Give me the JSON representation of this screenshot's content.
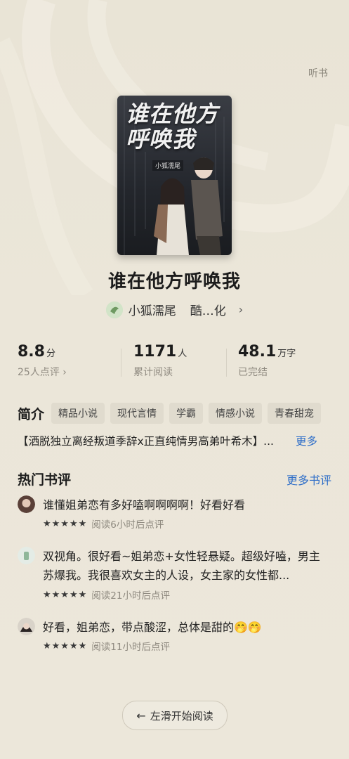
{
  "header": {
    "listen_label": "听书"
  },
  "book": {
    "cover_title": "谁在他方呼唤我",
    "cover_author": "小狐濡尾",
    "title": "谁在他方呼唤我",
    "author": "小狐濡尾",
    "publisher": "酷…化"
  },
  "stats": {
    "rating": "8.8",
    "rating_unit": "分",
    "rating_sub": "25人点评 ›",
    "readers": "1171",
    "readers_unit": "人",
    "readers_sub": "累计阅读",
    "words": "48.1",
    "words_unit": "万字",
    "words_sub": "已完结"
  },
  "intro": {
    "heading": "简介",
    "tags": [
      "精品小说",
      "现代言情",
      "学霸",
      "情感小说",
      "青春甜宠"
    ],
    "synopsis": "【洒脱独立离经叛道季辞x正直纯情男高弟叶希木】...",
    "more": "更多"
  },
  "reviews_section": {
    "heading": "热门书评",
    "more": "更多书评",
    "items": [
      {
        "text": "谁懂姐弟恋有多好嗑啊啊啊啊！好看好看",
        "stars": "★★★★★",
        "meta": "阅读6小时后点评"
      },
      {
        "text": "双视角。很好看~姐弟恋+女性轻悬疑。超级好嗑，男主苏爆我。我很喜欢女主的人设，女主家的女性都...",
        "stars": "★★★★★",
        "meta": "阅读21小时后点评"
      },
      {
        "text": "好看，姐弟恋，带点酸涩，总体是甜的🤭🤭",
        "stars": "★★★★★",
        "meta": "阅读11小时后点评"
      }
    ]
  },
  "footer": {
    "read_button": "左滑开始阅读"
  }
}
